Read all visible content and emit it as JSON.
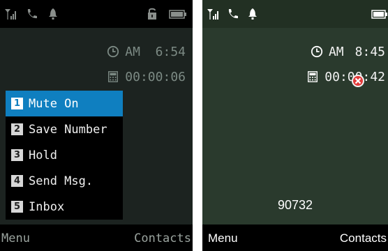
{
  "left": {
    "time": "AM  6:54",
    "call_duration": "00:00:06",
    "menu_items": [
      {
        "num": "1",
        "label": "Mute On"
      },
      {
        "num": "2",
        "label": "Save Number"
      },
      {
        "num": "3",
        "label": "Hold"
      },
      {
        "num": "4",
        "label": "Send Msg."
      },
      {
        "num": "5",
        "label": "Inbox"
      }
    ],
    "selected_index": 0,
    "softkeys": {
      "left": "Menu",
      "right": "Contacts"
    }
  },
  "right": {
    "time_ampm": "AM",
    "time": "8:45",
    "call_duration": "00:00:42",
    "dialed_number": "90732",
    "softkeys": {
      "left": "Menu",
      "right": "Contacts"
    }
  },
  "icons": [
    "signal-icon",
    "call-icon",
    "bell-icon",
    "lock-icon",
    "battery-icon",
    "clock-icon",
    "timer-icon",
    "cancel-icon"
  ],
  "colors": {
    "menu_highlight": "#0f7fc0",
    "screen_left_bg": "#1c2320",
    "screen_right_bg": "#2a3a2d"
  }
}
